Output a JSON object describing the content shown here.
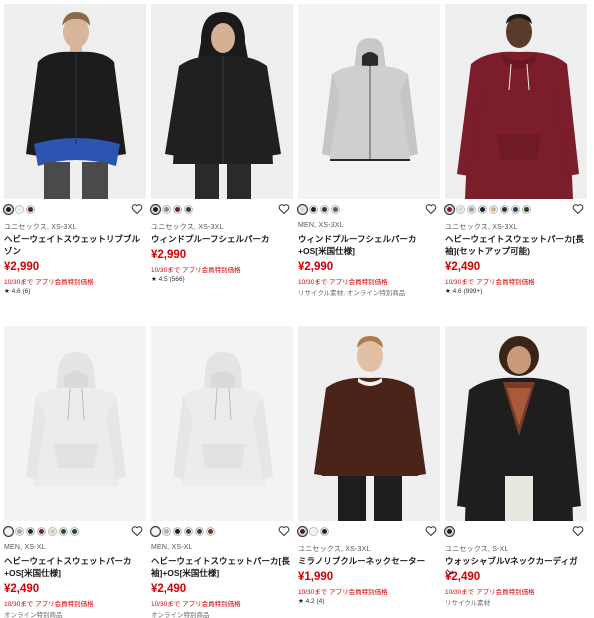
{
  "colors": {
    "price_red": "#d10000",
    "promo_red": "#d10000"
  },
  "products": [
    {
      "swatches": [
        "#1e1e1e",
        "#ececec",
        "#4a2222"
      ],
      "meta": "ユニセックス, XS-3XL",
      "title": "ヘビーウェイトスウェットリブブルゾン",
      "price": "¥2,990",
      "promo": "10/30まで アプリ会員特別価格",
      "rating": "4.6",
      "reviews": "(6)",
      "note": ""
    },
    {
      "swatches": [
        "#1e1e1e",
        "#8a8a8a",
        "#5a2a2a",
        "#3a3a3a"
      ],
      "meta": "ユニセックス, XS-3XL",
      "title": "ウィンドプルーフシェルパーカ",
      "price": "¥2,990",
      "promo": "10/30まで アプリ会員特別価格",
      "rating": "4.5",
      "reviews": "(566)",
      "note": ""
    },
    {
      "swatches": [
        "#d6d6d6",
        "#1e1e1e",
        "#2f3b2a",
        "#5a5a5a"
      ],
      "meta": "MEN, XS-3XL",
      "title": "ウィンドプルーフシェルパーカ+OS[米国仕様]",
      "price": "¥2,990",
      "promo": "10/30まで アプリ会員特別価格",
      "rating": "",
      "reviews": "",
      "note": "リサイクル素材, オンライン特別商品"
    },
    {
      "swatches": [
        "#7a1d28",
        "#d8d8d8",
        "#9a9a9a",
        "#1e1e1e",
        "#c9b48a",
        "#3a2a1f",
        "#2f3b4f",
        "#2a3a2a"
      ],
      "meta": "ユニセックス, XS-3XL",
      "title": "ヘビーウェイトスウェットパーカ[長袖](セットアップ可能)",
      "price": "¥2,490",
      "promo": "10/30まで アプリ会員特別価格",
      "rating": "4.6",
      "reviews": "(999+)",
      "note": ""
    },
    {
      "swatches": [
        "#f2f2f2",
        "#a8a8a8",
        "#2a2a2a",
        "#6a2a2a",
        "#d9c8b0",
        "#2a4a3a",
        "#2f3b4f"
      ],
      "meta": "MEN, XS-XL",
      "title": "ヘビーウェイトスウェットパーカ+OS[米国仕様]",
      "price": "¥2,490",
      "promo": "10/30まで アプリ会員特別価格",
      "rating": "",
      "reviews": "",
      "note": "オンライン特別商品"
    },
    {
      "swatches": [
        "#f2f2f2",
        "#b0b0b0",
        "#1e1e1e",
        "#2f4a3a",
        "#2f3b4f",
        "#5a3a2a"
      ],
      "meta": "MEN, XS-XL",
      "title": "ヘビーウェイトスウェットパーカ[長袖]+OS[米国仕様]",
      "price": "¥2,490",
      "promo": "10/30まで アプリ会員特別価格",
      "rating": "",
      "reviews": "",
      "note": "オンライン特別商品"
    },
    {
      "swatches": [
        "#4a2418",
        "#eeeeee",
        "#1e1e1e"
      ],
      "meta": "ユニセックス, XS-3XL",
      "title": "ミラノリブクルーネックセーター",
      "price": "¥1,990",
      "promo": "10/30まで アプリ会員特別価格",
      "rating": "4.2",
      "reviews": "(4)",
      "note": ""
    },
    {
      "swatches": [
        "#1e1e1e"
      ],
      "meta": "ユニセックス, S-XL",
      "title": "ウォッシャブルVネックカーディガン",
      "price": "¥2,490",
      "promo": "10/30まで アプリ会員特別価格",
      "rating": "",
      "reviews": "",
      "note": "リサイクル素材"
    }
  ]
}
